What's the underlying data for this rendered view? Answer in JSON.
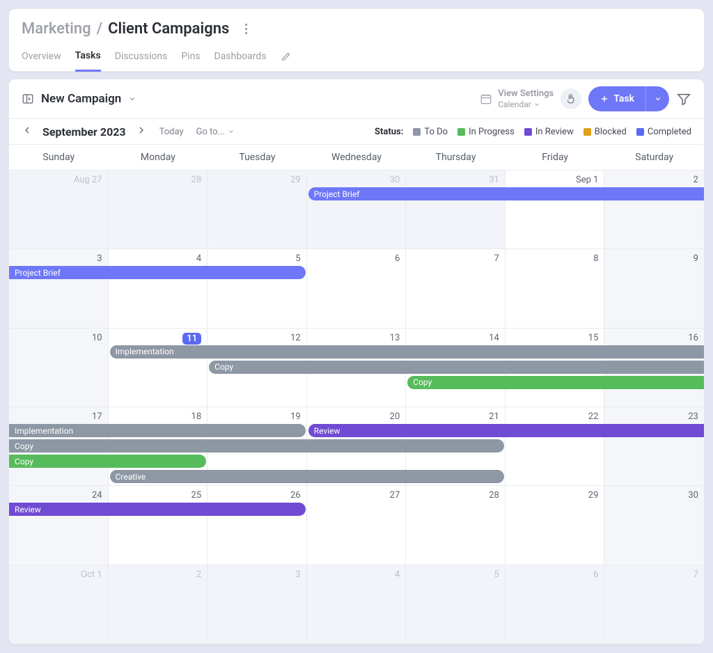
{
  "breadcrumb": {
    "parent": "Marketing",
    "current": "Client Campaigns"
  },
  "tabs": [
    "Overview",
    "Tasks",
    "Discussions",
    "Pins",
    "Dashboards"
  ],
  "activeTabIndex": 1,
  "viewName": "New Campaign",
  "viewSettings": {
    "title": "View Settings",
    "subtitle": "Calendar"
  },
  "taskButton": "Task",
  "period": "September 2023",
  "todayLabel": "Today",
  "gotoLabel": "Go to...",
  "statusLabel": "Status:",
  "statuses": [
    {
      "label": "To Do",
      "color": "#8e97a4"
    },
    {
      "label": "In Progress",
      "color": "#56bb5b"
    },
    {
      "label": "In Review",
      "color": "#704bd3"
    },
    {
      "label": "Blocked",
      "color": "#e2a016"
    },
    {
      "label": "Completed",
      "color": "#5a6af1"
    }
  ],
  "daysOfWeek": [
    "Sunday",
    "Monday",
    "Tuesday",
    "Wednesday",
    "Thursday",
    "Friday",
    "Saturday"
  ],
  "weeks": [
    [
      {
        "label": "Aug 27",
        "outOfMonth": true,
        "weekend": true
      },
      {
        "label": "28",
        "outOfMonth": true
      },
      {
        "label": "29",
        "outOfMonth": true
      },
      {
        "label": "30",
        "outOfMonth": true
      },
      {
        "label": "31",
        "outOfMonth": true
      },
      {
        "label": "Sep 1"
      },
      {
        "label": "2",
        "weekend": true
      }
    ],
    [
      {
        "label": "3",
        "weekend": true
      },
      {
        "label": "4"
      },
      {
        "label": "5"
      },
      {
        "label": "6"
      },
      {
        "label": "7"
      },
      {
        "label": "8"
      },
      {
        "label": "9",
        "weekend": true
      }
    ],
    [
      {
        "label": "10",
        "weekend": true
      },
      {
        "label": "11",
        "today": true
      },
      {
        "label": "12"
      },
      {
        "label": "13"
      },
      {
        "label": "14"
      },
      {
        "label": "15"
      },
      {
        "label": "16",
        "weekend": true
      }
    ],
    [
      {
        "label": "17",
        "weekend": true
      },
      {
        "label": "18"
      },
      {
        "label": "19"
      },
      {
        "label": "20"
      },
      {
        "label": "21"
      },
      {
        "label": "22"
      },
      {
        "label": "23",
        "weekend": true
      }
    ],
    [
      {
        "label": "24",
        "weekend": true
      },
      {
        "label": "25"
      },
      {
        "label": "26"
      },
      {
        "label": "27"
      },
      {
        "label": "28"
      },
      {
        "label": "29"
      },
      {
        "label": "30",
        "weekend": true
      }
    ],
    [
      {
        "label": "Oct 1",
        "outOfMonth": true,
        "weekend": true
      },
      {
        "label": "2",
        "outOfMonth": true
      },
      {
        "label": "3",
        "outOfMonth": true
      },
      {
        "label": "4",
        "outOfMonth": true
      },
      {
        "label": "5",
        "outOfMonth": true
      },
      {
        "label": "6",
        "outOfMonth": true
      },
      {
        "label": "7",
        "outOfMonth": true,
        "weekend": true
      }
    ]
  ],
  "events": [
    {
      "title": "Project Brief",
      "color": "#6e77f7",
      "week": 0,
      "startCol": 3,
      "endCol": 7,
      "slot": 0,
      "openEnd": true
    },
    {
      "title": "Project Brief",
      "color": "#6e77f7",
      "week": 1,
      "startCol": 0,
      "endCol": 3,
      "slot": 0,
      "openStart": true
    },
    {
      "title": "Implementation",
      "color": "#8e97a4",
      "week": 2,
      "startCol": 1,
      "endCol": 7,
      "slot": 0,
      "openEnd": true
    },
    {
      "title": "Copy",
      "color": "#8e97a4",
      "week": 2,
      "startCol": 2,
      "endCol": 7,
      "slot": 1,
      "openEnd": true
    },
    {
      "title": "Copy",
      "color": "#56bb5b",
      "week": 2,
      "startCol": 4,
      "endCol": 7,
      "slot": 2,
      "openEnd": true
    },
    {
      "title": "Implementation",
      "color": "#8e97a4",
      "week": 3,
      "startCol": 0,
      "endCol": 3,
      "slot": 0,
      "openStart": true
    },
    {
      "title": "Review",
      "color": "#704bd3",
      "week": 3,
      "startCol": 3,
      "endCol": 7,
      "slot": 0,
      "openEnd": true
    },
    {
      "title": "Copy",
      "color": "#8e97a4",
      "week": 3,
      "startCol": 0,
      "endCol": 5,
      "slot": 1,
      "openStart": true
    },
    {
      "title": "Copy",
      "color": "#56bb5b",
      "week": 3,
      "startCol": 0,
      "endCol": 2,
      "slot": 2,
      "openStart": true
    },
    {
      "title": "Creative",
      "color": "#8e97a4",
      "week": 3,
      "startCol": 1,
      "endCol": 5,
      "slot": 3
    },
    {
      "title": "Review",
      "color": "#704bd3",
      "week": 4,
      "startCol": 0,
      "endCol": 3,
      "slot": 0,
      "openStart": true
    }
  ]
}
